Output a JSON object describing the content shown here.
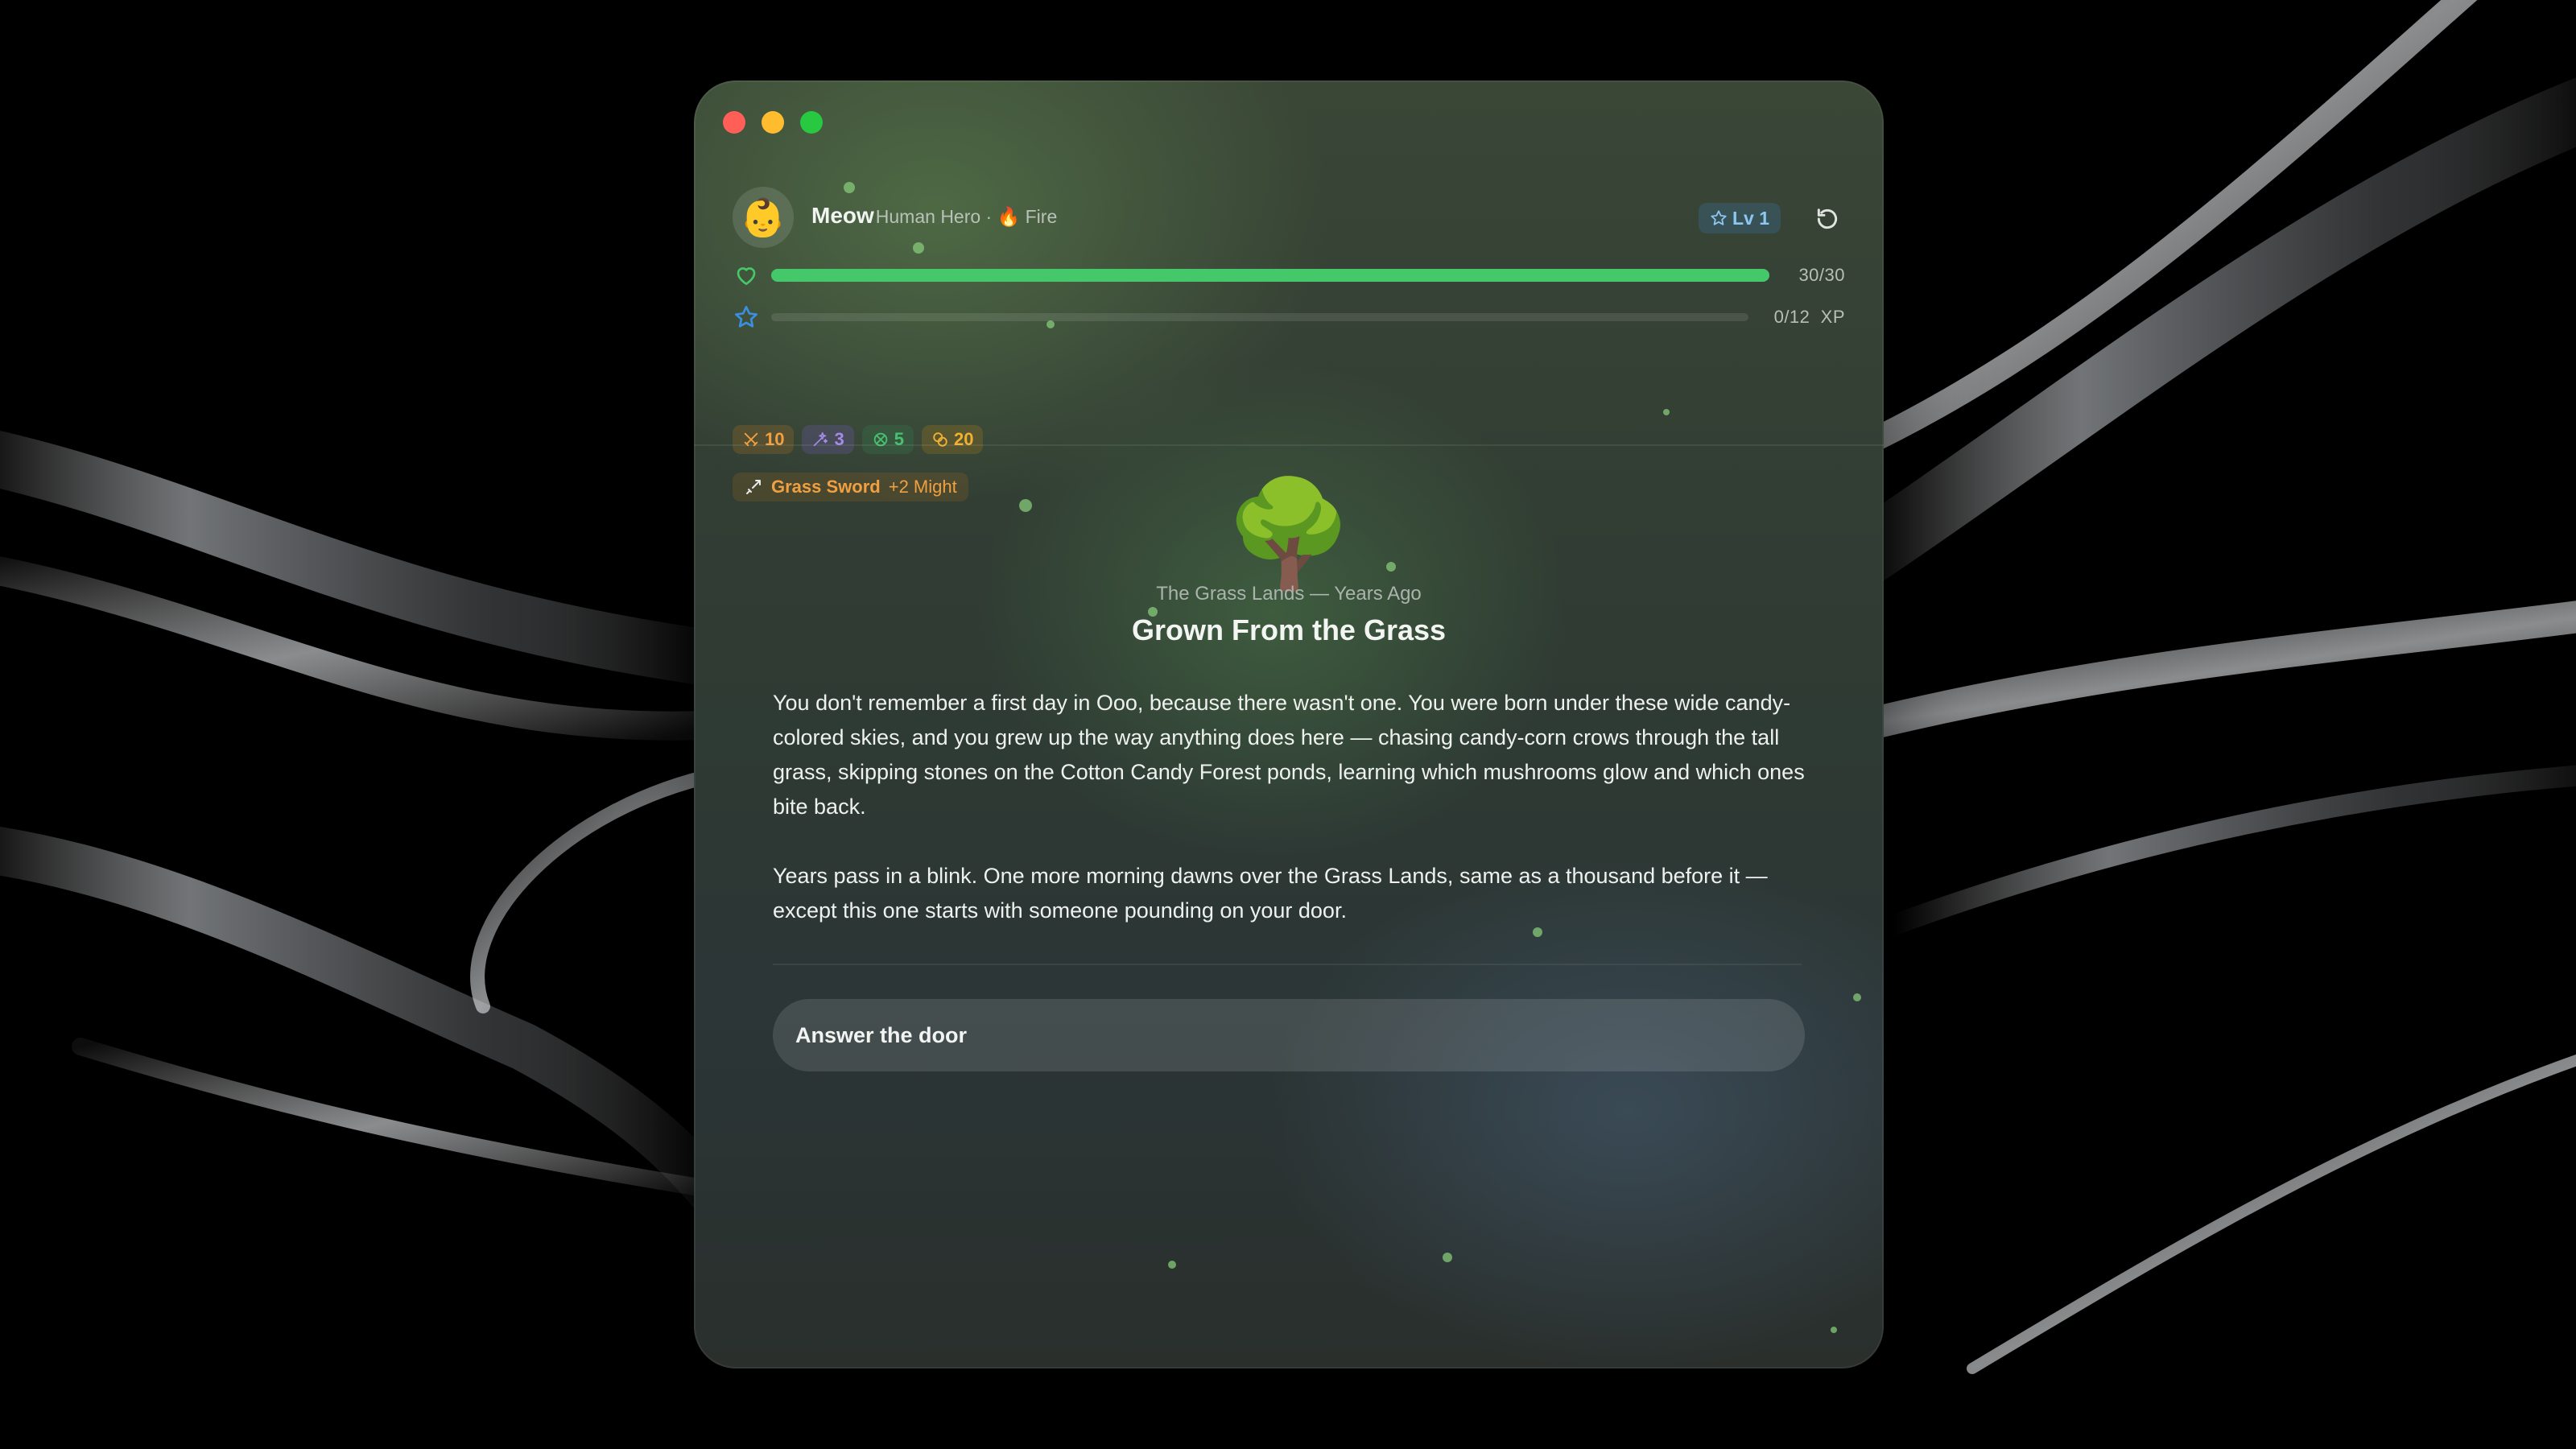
{
  "window": {
    "controls": [
      "close",
      "minimize",
      "zoom"
    ]
  },
  "hero": {
    "avatar_emoji": "👶",
    "name": "Meow",
    "subtitle": "Human Hero · 🔥 Fire",
    "level_label": "Lv 1"
  },
  "health": {
    "value_text": "30/30",
    "fraction": 1.0,
    "color": "#45c86a"
  },
  "xp": {
    "value_text": "0/12",
    "unit": "XP",
    "fraction": 0.0,
    "color": "#3a8fe0"
  },
  "stats": [
    {
      "icon": "crossed-swords-icon",
      "value": "10",
      "color": "#f0a040"
    },
    {
      "icon": "sparkles-icon",
      "value": "3",
      "color": "#a58ae8"
    },
    {
      "icon": "shield-icon",
      "value": "5",
      "color": "#48c070"
    },
    {
      "icon": "coins-icon",
      "value": "20",
      "color": "#f0b030"
    }
  ],
  "weapon": {
    "icon": "sword-icon",
    "name": "Grass Sword",
    "bonus": "+2 Might"
  },
  "scene": {
    "emoji": "🌳",
    "caption": "The Grass Lands — Years Ago",
    "title": "Grown From the Grass",
    "paragraphs": [
      "You don't remember a first day in Ooo, because there wasn't one. You were born under these wide candy-colored skies, and you grew up the way anything does here — chasing candy-corn crows through the tall grass, skipping stones on the Cotton Candy Forest ponds, learning which mushrooms glow and which ones bite back.",
      "Years pass in a blink. One more morning dawns over the Grass Lands, same as a thousand before it — except this one starts with someone pounding on your door."
    ]
  },
  "choices": [
    {
      "label": "Answer the door"
    }
  ]
}
